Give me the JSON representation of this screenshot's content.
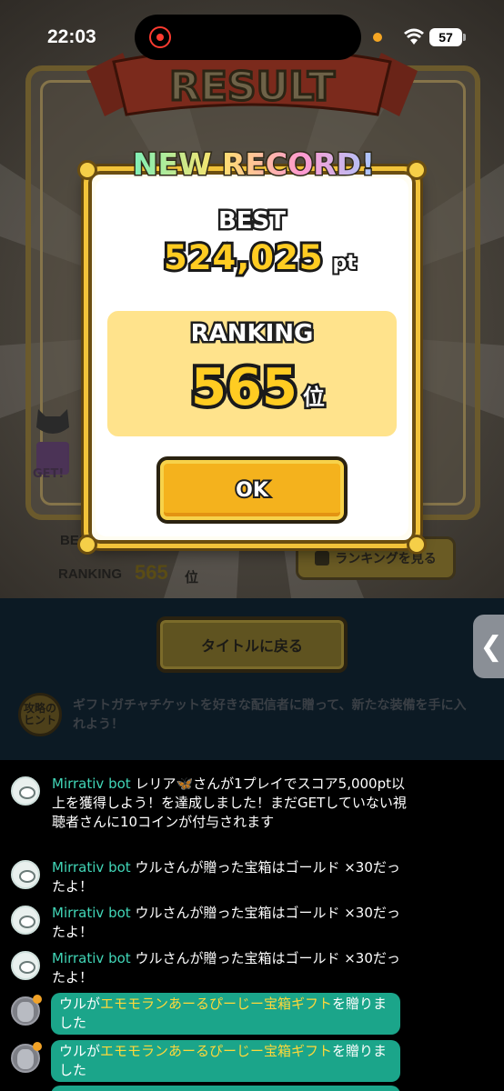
{
  "status_bar": {
    "time": "22:03",
    "battery": "57"
  },
  "game": {
    "banner_title": "RESULT",
    "background": {
      "best_label": "BEST",
      "ranking_label": "RANKING",
      "ranking_value": "565",
      "ranking_unit": "位",
      "get_label": "GET!",
      "ranking_button": "ランキングを見る"
    },
    "modal": {
      "headline": "NEW RECORD!",
      "best_label": "BEST",
      "best_value": "524,025",
      "best_unit": "pt",
      "ranking_label": "RANKING",
      "ranking_value": "565",
      "ranking_unit": "位",
      "ok_label": "OK"
    },
    "title_button": "タイトルに戻る",
    "hint_badge": "攻略の ヒント",
    "hint_text": "ギフトガチャチケットを好きな配信者に贈って、新たな装備を手に入れよう！"
  },
  "side_tab_icon": "chevron-left-icon",
  "chat": {
    "messages": [
      {
        "sender": "Mirrativ bot",
        "text": "レリア🦋さんが1プレイでスコア5,000pt以上を獲得しよう！を達成しました！まだGETしていない視聴者さんに10コインが付与されます"
      },
      {
        "sender": "Mirrativ bot",
        "text": "ウルさんが贈った宝箱はゴールド ×30だったよ！"
      },
      {
        "sender": "Mirrativ bot",
        "text": "ウルさんが贈った宝箱はゴールド ×30だったよ！"
      },
      {
        "sender": "Mirrativ bot",
        "text": "ウルさんが贈った宝箱はゴールド ×30だったよ！"
      }
    ],
    "gifts": [
      {
        "user": "ウル",
        "connector": "が",
        "item": "エモモランあーるぴーじー宝箱ギフト",
        "suffix": "を贈りました"
      },
      {
        "user": "ウル",
        "connector": "が",
        "item": "エモモランあーるぴーじー宝箱ギフト",
        "suffix": "を贈りました"
      }
    ]
  },
  "colors": {
    "accent_gold": "#ffcc22",
    "chat_sender": "#41d6b7",
    "gift_bubble": "#1ba58a",
    "gift_highlight": "#ffd83a"
  }
}
